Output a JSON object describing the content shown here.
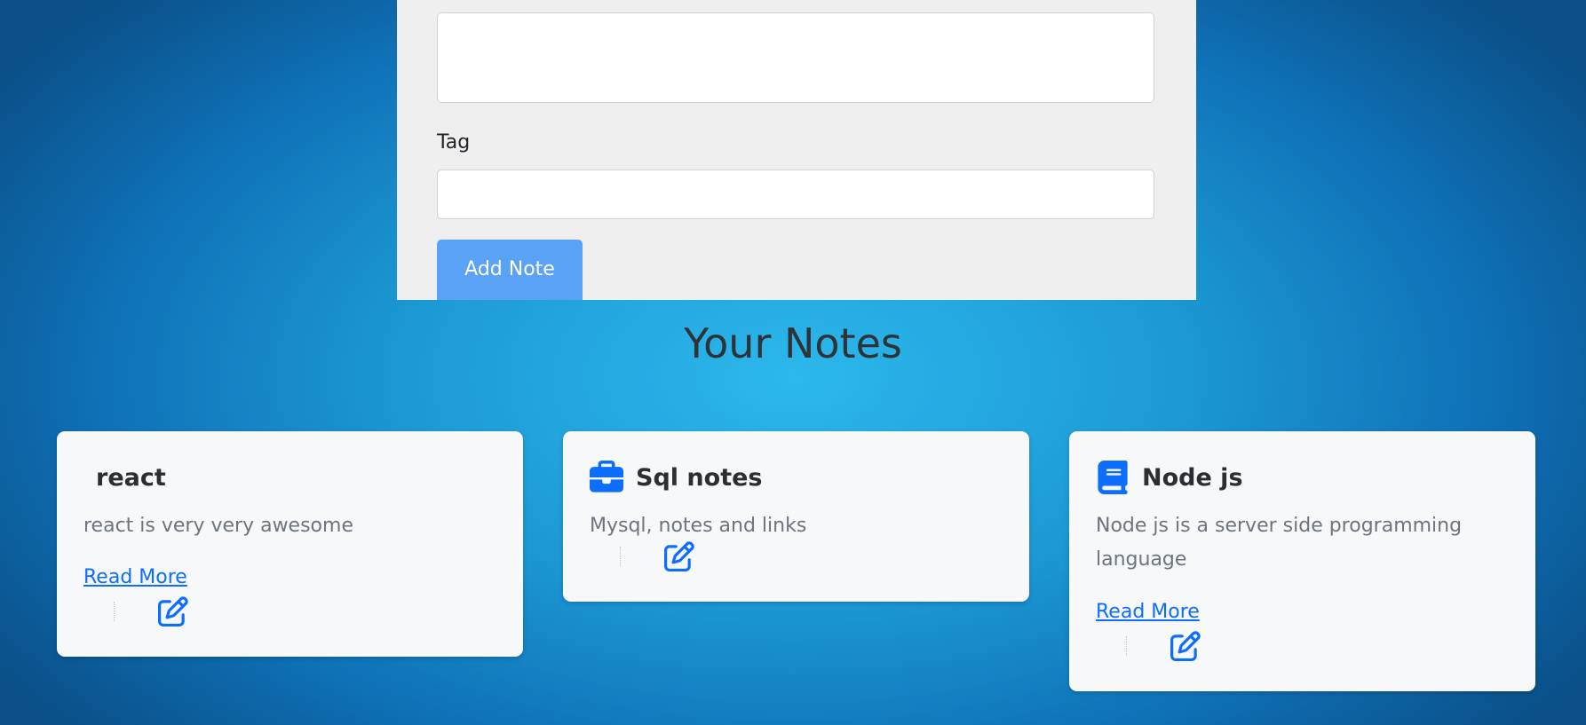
{
  "form": {
    "description_value": "",
    "tag_label": "Tag",
    "tag_value": "",
    "add_button_label": "Add Note"
  },
  "notes_section": {
    "title": "Your Notes"
  },
  "notes": [
    {
      "title": "react",
      "description": "react is very very awesome",
      "icon": "",
      "read_more": "Read More"
    },
    {
      "title": "Sql notes",
      "description": "Mysql, notes and links",
      "icon": "briefcase-icon",
      "read_more": ""
    },
    {
      "title": "Node js",
      "description": "Node js is a server side programming language",
      "icon": "book-icon",
      "read_more": "Read More"
    }
  ],
  "colors": {
    "accent": "#0d6efd",
    "button": "#5aa2f5",
    "card_bg": "#f6f8fa",
    "panel_bg": "#efefef"
  }
}
